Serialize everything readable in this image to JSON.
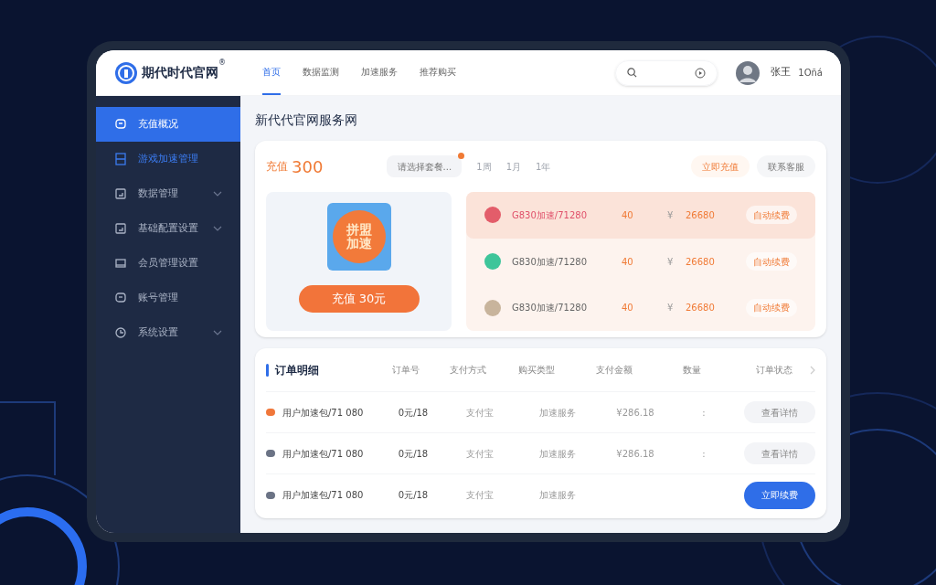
{
  "header": {
    "logo": "期代时代官网",
    "logo_mark": "®",
    "nav": [
      {
        "label": "首页",
        "selected": true
      },
      {
        "label": "数据监测",
        "selected": false
      },
      {
        "label": "加速服务",
        "selected": false
      },
      {
        "label": "推荐购买",
        "selected": false
      }
    ],
    "user": {
      "name": "张王",
      "extra": "1Oñá"
    }
  },
  "sidebar": {
    "items": [
      {
        "label": "充值概况",
        "selected": true,
        "current": false,
        "expandable": false
      },
      {
        "label": "游戏加速管理",
        "selected": false,
        "current": true,
        "expandable": false
      },
      {
        "label": "数据管理",
        "selected": false,
        "current": false,
        "expandable": true
      },
      {
        "label": "基础配置设置",
        "selected": false,
        "current": false,
        "expandable": true
      },
      {
        "label": "会员管理设置",
        "selected": false,
        "current": false,
        "expandable": false
      },
      {
        "label": "账号管理",
        "selected": false,
        "current": false,
        "expandable": false
      },
      {
        "label": "系统设置",
        "selected": false,
        "current": false,
        "expandable": true
      }
    ]
  },
  "page_title": "新代代官网服务网",
  "recharge": {
    "price_label": "充值",
    "price": "300",
    "plan_select": {
      "placeholder": "请选择套餐..."
    },
    "periods": [
      {
        "label": "1周",
        "selected": false
      },
      {
        "label": "1月",
        "selected": false
      },
      {
        "label": "1年",
        "selected": false
      }
    ],
    "actions": [
      {
        "label": "立即充值",
        "kind": "accent"
      },
      {
        "label": "联系客服",
        "kind": "plain"
      }
    ],
    "product": {
      "art_text": "拼盟加速",
      "button": "充值 30元"
    },
    "plans": [
      {
        "name": "G830加速/71280",
        "count": "40",
        "currency": "¥",
        "price": "26680",
        "action": "自动续费",
        "color": "#e35d6a",
        "selected": true
      },
      {
        "name": "G830加速/71280",
        "count": "40",
        "currency": "¥",
        "price": "26680",
        "action": "自动续费",
        "color": "#3ec59a",
        "selected": false
      },
      {
        "name": "G830加速/71280",
        "count": "40",
        "currency": "¥",
        "price": "26680",
        "action": "自动续费",
        "color": "#c8b49c",
        "selected": false
      }
    ]
  },
  "orders": {
    "columns": [
      "订单明细",
      "订单号",
      "支付方式",
      "购买类型",
      "支付金额",
      "数量",
      "订单状态"
    ],
    "rows": [
      {
        "color": "#f0773a",
        "cells": [
          "用户加速包/71 080",
          "0元/18",
          "支付宝",
          "加速服务",
          "¥286.18",
          ":"
        ],
        "action": {
          "label": "查看详情",
          "kind": "plain"
        }
      },
      {
        "color": "#6b7385",
        "cells": [
          "用户加速包/71 080",
          "0元/18",
          "支付宝",
          "加速服务",
          "¥286.18",
          ":"
        ],
        "action": {
          "label": "查看详情",
          "kind": "plain"
        }
      },
      {
        "color": "#6b7385",
        "cells": [
          "用户加速包/71 080",
          "0元/18",
          "支付宝",
          "加速服务",
          "",
          ""
        ],
        "action": {
          "label": "立即续费",
          "kind": "primary"
        }
      }
    ]
  }
}
